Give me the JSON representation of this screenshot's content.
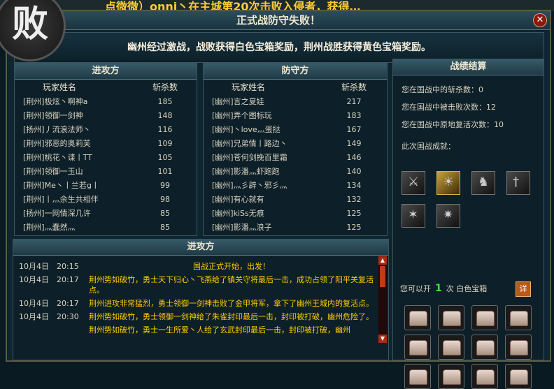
{
  "background_text": "点微微）onni丶在主城第20次击败入侵者，获得…",
  "window": {
    "title": "正式战防守失败！",
    "close": "✕"
  },
  "badge": "败",
  "banner": "幽州经过激战，战败获得白色宝箱奖励，荆州战胜获得黄色宝箱奖励。",
  "attack": {
    "title": "进攻方",
    "col_name": "玩家姓名",
    "col_kill": "斩杀数",
    "rows": [
      {
        "name": "[荆州]极炫丶啊神a",
        "kill": "185"
      },
      {
        "name": "[荆州]领御一剑神",
        "kill": "148"
      },
      {
        "name": "[扬州]丿流浪法师丶",
        "kill": "116"
      },
      {
        "name": "[荆州]邪恶的奥莉芙",
        "kill": "109"
      },
      {
        "name": "[荆州]桃花丶谍丨TT",
        "kill": "105"
      },
      {
        "name": "[荆州]领御一玉山",
        "kill": "101"
      },
      {
        "name": "[荆州]Me丶丨兰若g丨",
        "kill": "99"
      },
      {
        "name": "[荆州]丨灬余生共相伴",
        "kill": "98"
      },
      {
        "name": "[扬州]一网情深几许",
        "kill": "85"
      },
      {
        "name": "[荆州]灬蠢然灬",
        "kill": "85"
      }
    ]
  },
  "defend": {
    "title": "防守方",
    "col_name": "玩家姓名",
    "col_kill": "斩杀数",
    "rows": [
      {
        "name": "[幽州]言之夏娃",
        "kill": "217"
      },
      {
        "name": "[幽州]弄个图标玩",
        "kill": "183"
      },
      {
        "name": "[幽州]丶love灬蛋挞",
        "kill": "167"
      },
      {
        "name": "[幽州]兄弟情丨路边丶",
        "kill": "149"
      },
      {
        "name": "[幽州]苍何剑挽百里霜",
        "kill": "146"
      },
      {
        "name": "[幽州]影潘灬虾跑跑",
        "kill": "140"
      },
      {
        "name": "[幽州]灬彡辟丶邪彡灬",
        "kill": "134"
      },
      {
        "name": "[幽州]有心就有",
        "kill": "132"
      },
      {
        "name": "[幽州]kiSs无痕",
        "kill": "125"
      },
      {
        "name": "[幽州]影潘灬浪子",
        "kill": "125"
      }
    ]
  },
  "summary": {
    "title": "战绩结算",
    "kills": "您在国战中的斩杀数：0",
    "killed": "您在国战中被击败次数：12",
    "revives": "您在国战中原地复活次数：10",
    "achievements_label": "此次国战成就：",
    "achievement_icons": [
      "sword-icon",
      "warrior-gold-icon",
      "dragon-icon",
      "mace-icon",
      "thorn-icon",
      "spike-icon"
    ],
    "open_prefix": "您可以开",
    "open_count": "1",
    "open_suffix": "次  白色宝箱",
    "detail_button": "详",
    "chest_count": 12
  },
  "log": {
    "title": "进攻方",
    "entries": [
      {
        "date": "10月4日",
        "time": "20:15",
        "text": "国战正式开始，出发！",
        "center": true
      },
      {
        "date": "10月4日",
        "time": "20:17",
        "text": "荆州势如破竹，勇士天下归心丶飞燕给了镇关守将最后一击，成功占领了阳平关复活点。"
      },
      {
        "date": "10月4日",
        "time": "20:17",
        "text": "荆州进攻非常猛烈，勇士领御一剑神击败了金甲将军，拿下了幽州王城内的复活点。"
      },
      {
        "date": "10月4日",
        "time": "20:30",
        "text": "荆州势如破竹，勇士领御一剑神给了朱雀封印最后一击，封印被打破，幽州危险了。"
      },
      {
        "date": "",
        "time": "",
        "text": "荆州势如破竹，勇士一生所爱丶人给了玄武封印最后一击，封印被打破，幽州"
      }
    ],
    "scroll_up": "▲",
    "scroll_down": "▼"
  }
}
